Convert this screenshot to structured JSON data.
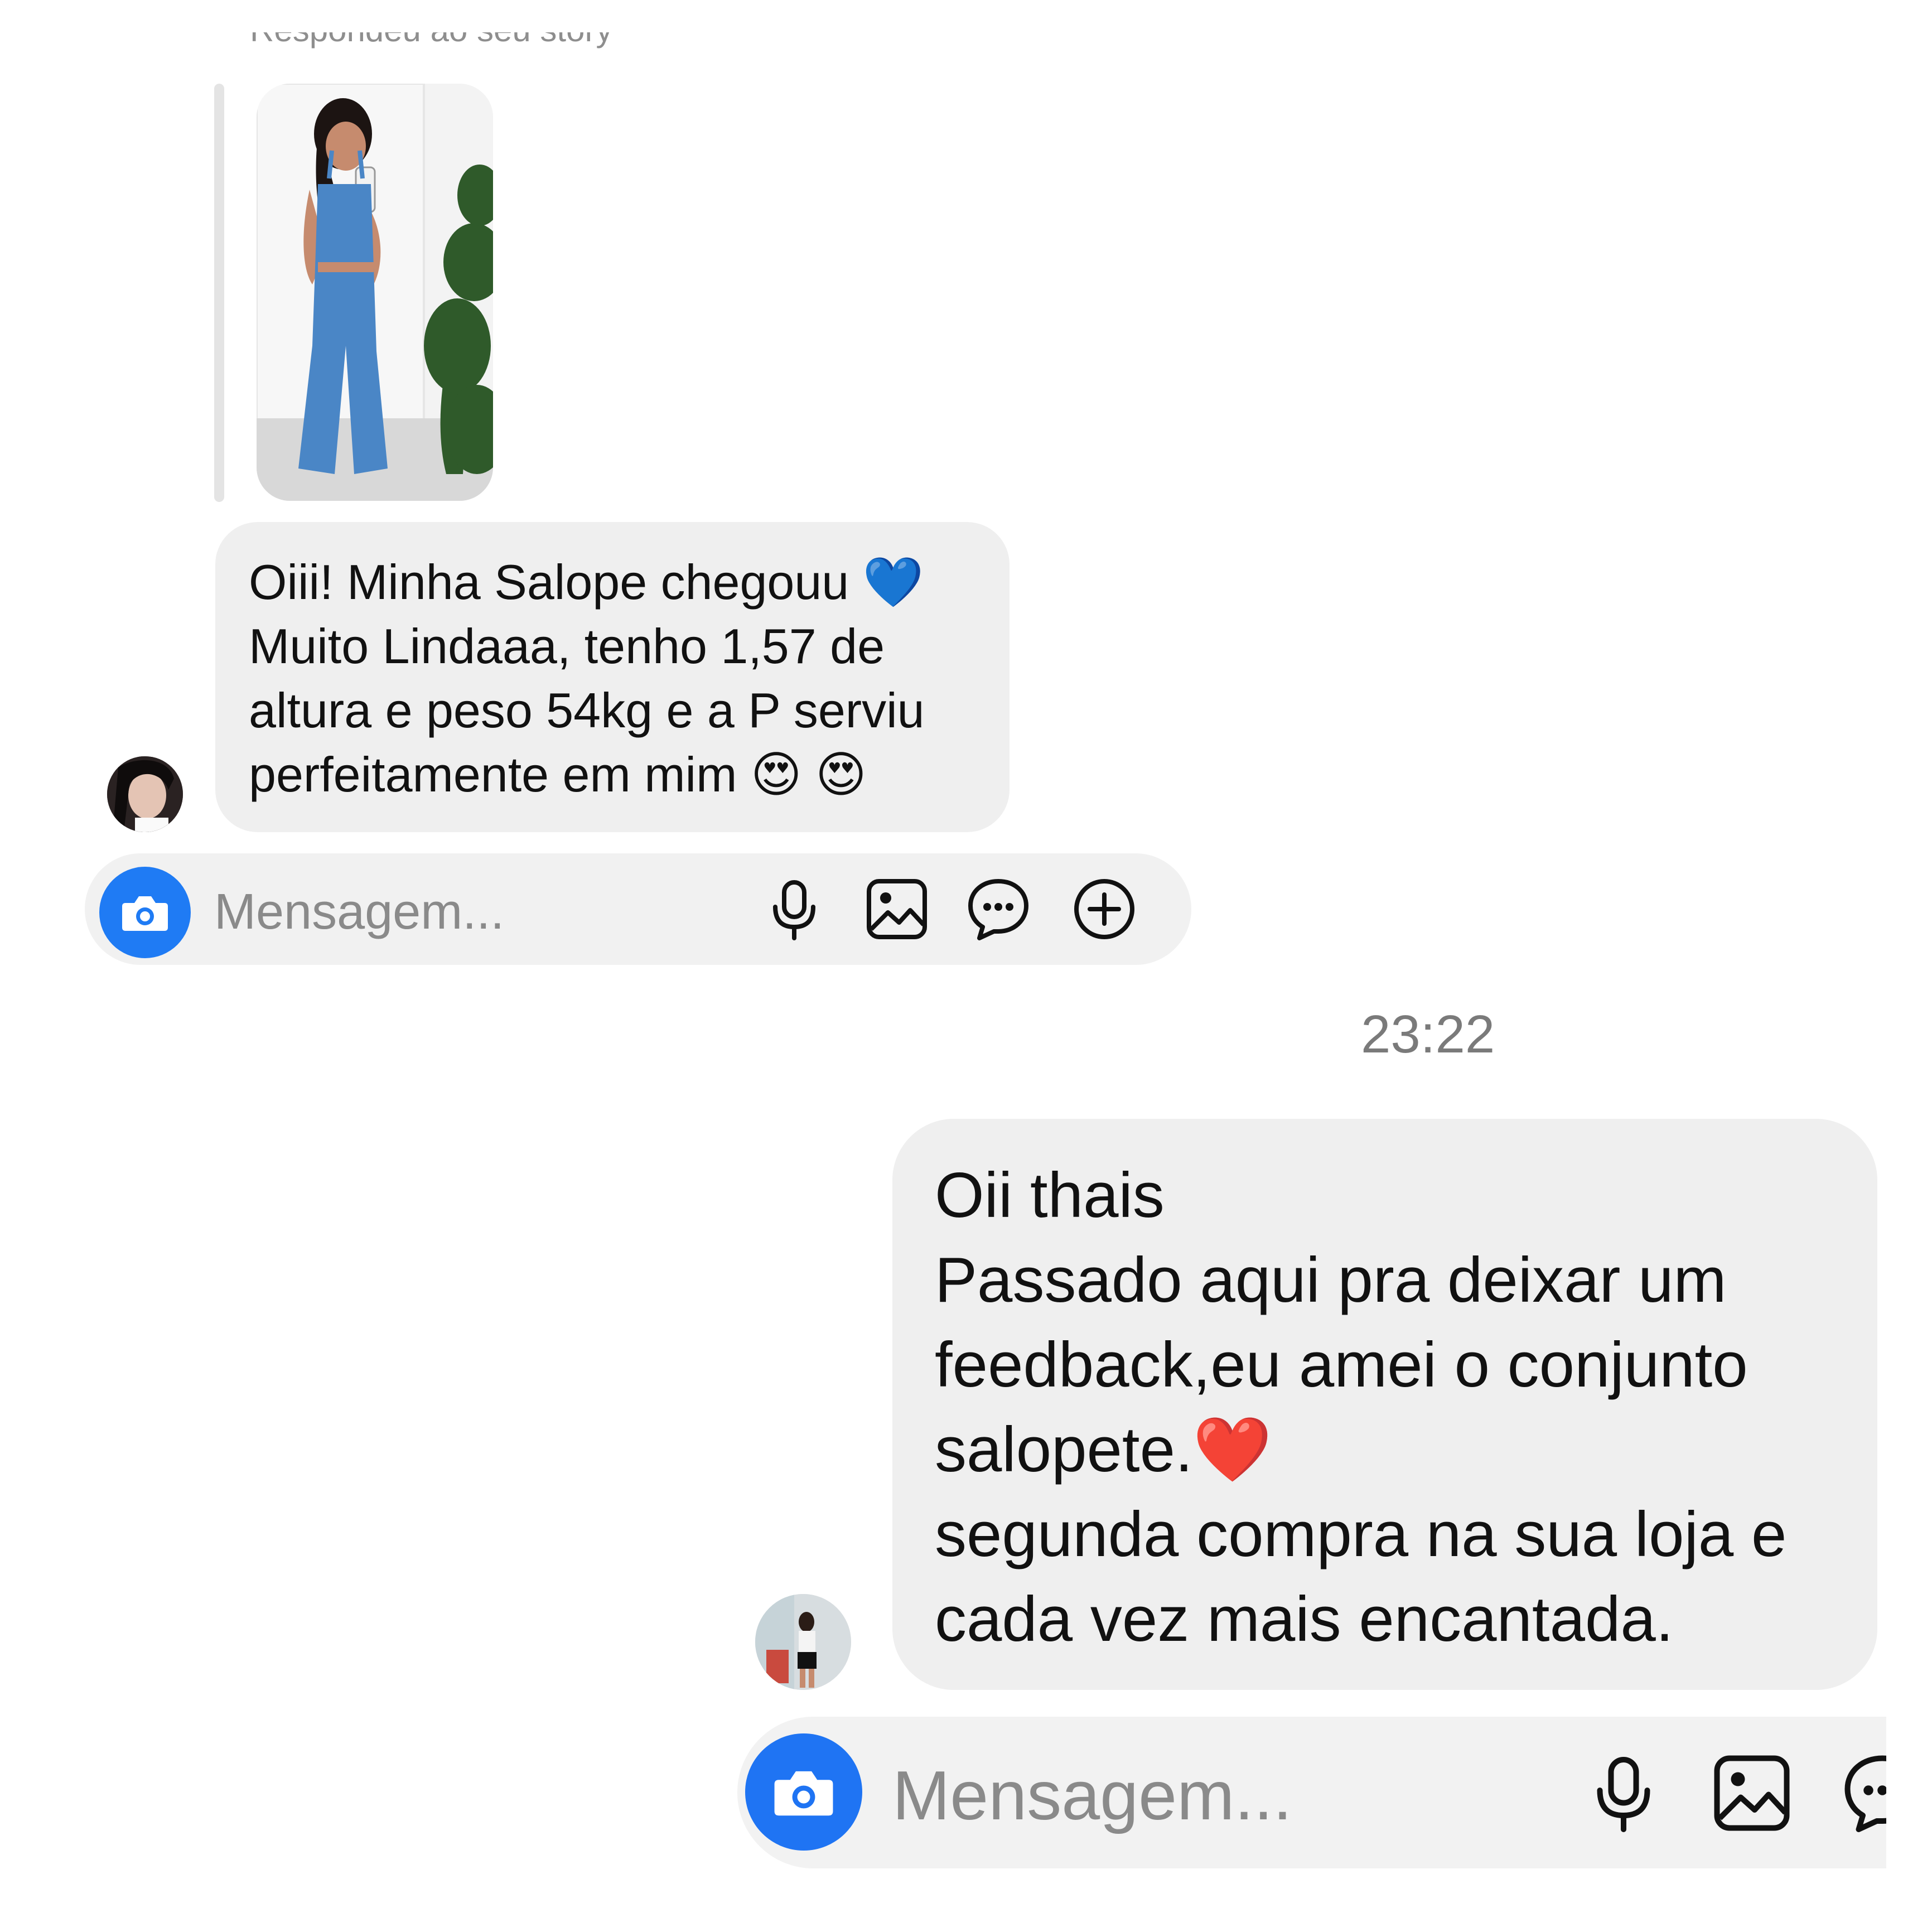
{
  "top": {
    "reply_label": "Respondeu ao seu story",
    "incoming_message": "Oiii! Minha Salope chegouu 💙 Muito Lindaaa, tenho 1,57 de altura e peso 54kg e a P serviu perfeitamente em mim 😍 😍",
    "composer": {
      "placeholder": "Mensagem...",
      "icons": [
        "camera-icon",
        "microphone-icon",
        "gallery-icon",
        "sticker-icon",
        "plus-icon"
      ]
    }
  },
  "bottom": {
    "timestamp": "23:22",
    "incoming_message_lines": [
      "Oii thais",
      "Passado aqui pra deixar um",
      "feedback,eu amei o conjunto",
      "salopete.❤️",
      "segunda compra na sua loja e",
      "cada vez mais encantada."
    ],
    "composer": {
      "placeholder": "Mensagem...",
      "icons": [
        "camera-icon",
        "microphone-icon",
        "gallery-icon",
        "sticker-icon"
      ]
    }
  },
  "colors": {
    "bubble": "#efefef",
    "camera_button": "#1f7bf4",
    "placeholder_text": "#8a8a8a",
    "timestamp_text": "#7a7a7a"
  }
}
